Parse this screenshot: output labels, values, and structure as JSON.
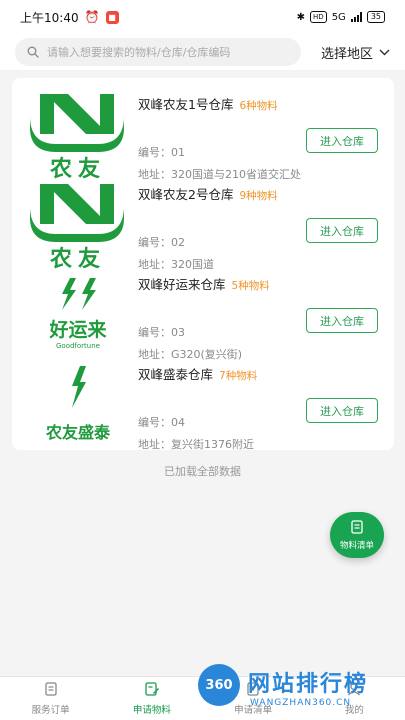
{
  "status_bar": {
    "time": "上午10:40",
    "battery": "35",
    "network": "5G"
  },
  "search": {
    "placeholder": "请输入想要搜索的物料/仓库/仓库编码",
    "value": ""
  },
  "region": {
    "label": "选择地区"
  },
  "warehouses": [
    {
      "name": "双峰农友1号仓库",
      "count": "6种物料",
      "code": "编号：01",
      "address": "地址：320国道与210省道交汇处",
      "button": "进入仓库",
      "logo": {
        "type": "nongyou-n",
        "text": "农友"
      }
    },
    {
      "name": "双峰农友2号仓库",
      "count": "9种物料",
      "code": "编号：02",
      "address": "地址：320国道",
      "button": "进入仓库",
      "logo": {
        "type": "nongyou-n",
        "text": "农友"
      }
    },
    {
      "name": "双峰好运来仓库",
      "count": "5种物料",
      "code": "编号：03",
      "address": "地址：G320(复兴街)",
      "button": "进入仓库",
      "logo": {
        "type": "bolts",
        "text": "好运来",
        "subtext": "Goodfortune"
      }
    },
    {
      "name": "双峰盛泰仓库",
      "count": "7种物料",
      "code": "编号：04",
      "address": "地址：复兴街1376附近",
      "button": "进入仓库",
      "logo": {
        "type": "bolts",
        "text": "农友盛泰"
      }
    }
  ],
  "footer_note": "已加载全部数据",
  "fab": {
    "label": "物料清单",
    "icon": "list-icon"
  },
  "tabs": [
    {
      "label": "服务订单",
      "icon": "order-icon",
      "active": false
    },
    {
      "label": "申请物料",
      "icon": "edit-icon",
      "active": true
    },
    {
      "label": "申请清单",
      "icon": "doc-icon",
      "active": false
    },
    {
      "label": "我的",
      "icon": "user-icon",
      "active": false
    }
  ],
  "watermark": {
    "badge": "360",
    "title": "网站排行榜",
    "url": "WANGZHAN360.CN"
  },
  "colors": {
    "primary_green": "#18a451",
    "count_orange": "#f0952a",
    "logo_green": "#1f9a3c",
    "watermark_blue": "#2a86d8"
  }
}
